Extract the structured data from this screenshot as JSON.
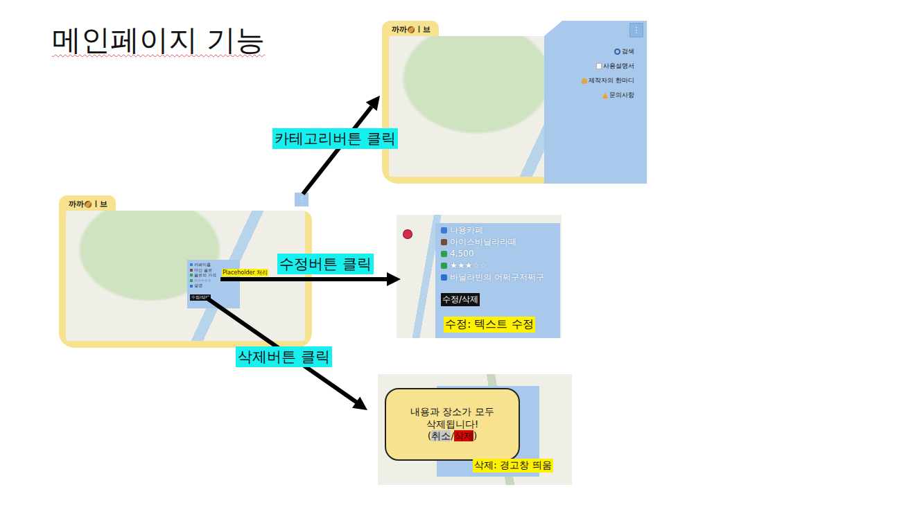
{
  "title": "메인페이지 기능",
  "main_view": {
    "tab": {
      "left": "까까",
      "right": "ㅣ브"
    },
    "category_button": "⋮",
    "popup_lines": [
      {
        "text": "카페이름",
        "color": "#3a7bd5"
      },
      {
        "text": "마신 음료",
        "color": "#7a4a2a"
      },
      {
        "text": "음료의 가격",
        "color": "#2e9e4f"
      },
      {
        "text": "☆☆☆☆☆",
        "color": "#2e9e4f"
      },
      {
        "text": "설명",
        "color": "#2f6fd0"
      }
    ],
    "edit_delete": "수정/삭제",
    "placeholder_note": "Placeholder 처리"
  },
  "flows": [
    {
      "label": "카테고리버튼 클릭"
    },
    {
      "label": "수정버튼 클릭"
    },
    {
      "label": "삭제버튼 클릭"
    }
  ],
  "category_view": {
    "tab": {
      "left": "까까",
      "right": "ㅣ브"
    },
    "menu_button": "⋮",
    "menu_items": [
      {
        "label": "검색",
        "kind": "search"
      },
      {
        "label": "사용설명서",
        "kind": "manual"
      },
      {
        "label": "제작자의 한마디",
        "kind": "maker"
      },
      {
        "label": "문의사항",
        "kind": "warning"
      }
    ]
  },
  "edit_view": {
    "fields": [
      {
        "text": "나용카페",
        "color": "#3a7bd5"
      },
      {
        "text": "아이스바닐라라떼",
        "color": "#7a4a2a"
      },
      {
        "text": "4,500",
        "color": "#2e9e4f"
      },
      {
        "text": "★★★☆☆",
        "color": "#2e9e4f"
      },
      {
        "text": "바닐라빈의 어쩌구저쩌구",
        "color": "#2f6fd0"
      }
    ],
    "button": "수정/삭제",
    "note": "수정: 텍스트 수정"
  },
  "delete_view": {
    "message_lines": [
      "내용과 장소가 모두",
      "삭제됩니다!"
    ],
    "open": "(",
    "cancel": "취소",
    "separator": "/",
    "delete": "삭제",
    "close": ")",
    "note": "삭제: 경고창 띄움"
  }
}
